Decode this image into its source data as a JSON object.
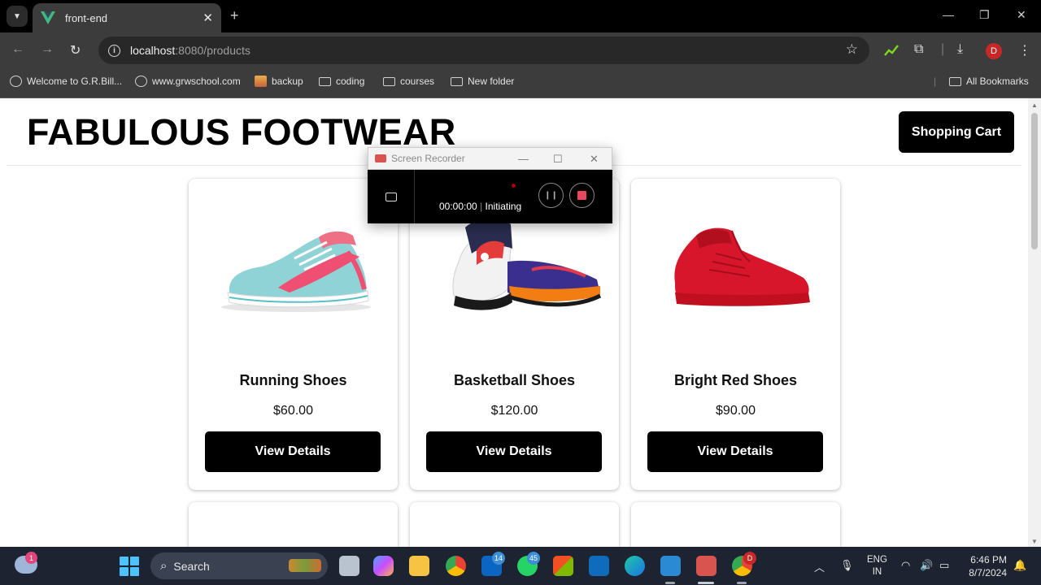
{
  "browser": {
    "tab_title": "front-end",
    "url_host": "localhost",
    "url_rest": ":8080/products",
    "bookmarks": [
      "Welcome to G.R.Bill...",
      "www.grwschool.com",
      "backup",
      "coding",
      "courses",
      "New folder"
    ],
    "all_bookmarks": "All Bookmarks",
    "profile_initial": "D"
  },
  "site": {
    "title": "FABULOUS FOOTWEAR",
    "cart_label": "Shopping Cart"
  },
  "products": [
    {
      "name": "Running Shoes",
      "price": "$60.00",
      "button": "View Details"
    },
    {
      "name": "Basketball Shoes",
      "price": "$120.00",
      "button": "View Details"
    },
    {
      "name": "Bright Red Shoes",
      "price": "$90.00",
      "button": "View Details"
    }
  ],
  "recorder": {
    "title": "Screen Recorder",
    "time": "00:00:00",
    "status": "Initiating"
  },
  "taskbar": {
    "weather_badge": "1",
    "search_label": "Search",
    "linkedin_badge": "14",
    "whatsapp_badge": "45",
    "chrome_badge": "D",
    "lang_line1": "ENG",
    "lang_line2": "IN",
    "time": "6:46 PM",
    "date": "8/7/2024"
  },
  "colors": {
    "accent": "#000000",
    "stop": "#e8475f",
    "chrome_dark": "#3c3c3c"
  }
}
